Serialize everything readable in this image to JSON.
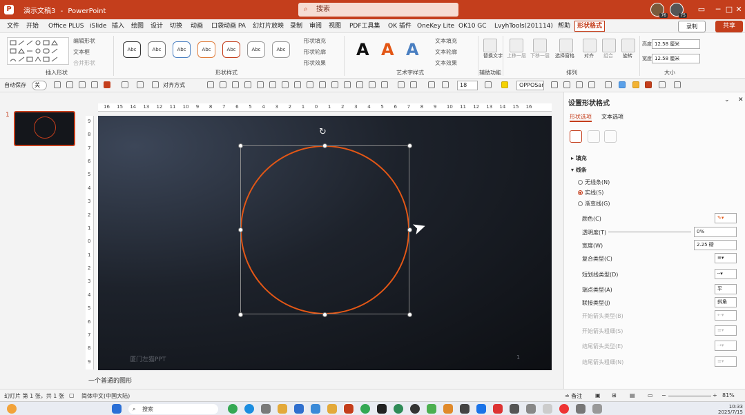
{
  "titlebar": {
    "app_name": "PowerPoint",
    "doc_title": "演示文稿3",
    "search_placeholder": "搜索",
    "avatar1_badge": "76",
    "avatar2_badge": "75",
    "minimize": "─",
    "restore": "□",
    "close": "✕"
  },
  "menubar": {
    "items": [
      "文件",
      "开始",
      "Office PLUS",
      "iSlide",
      "插入",
      "绘图",
      "设计",
      "切换",
      "动画",
      "口袋动画 PA",
      "幻灯片放映",
      "录制",
      "审阅",
      "视图",
      "PDF工具集",
      "OK 插件",
      "OneKey Lite",
      "OK10 GC",
      "LvyhTools(201114)",
      "帮助",
      "形状格式"
    ],
    "record_label": "录制",
    "share_label": "共享"
  },
  "ribbon": {
    "groups": [
      "插入形状",
      "形状样式",
      "艺术字样式",
      "辅助功能",
      "排列",
      "大小"
    ],
    "shape_edit": "编辑形状",
    "text_box": "文本框",
    "merge_shapes": "合并形状",
    "style_sample": "Abc",
    "fill": "形状填充",
    "outline": "形状轮廓",
    "effects": "形状效果",
    "text_fill": "文本填充",
    "text_outline": "文本轮廓",
    "text_effects": "文本效果",
    "alt_text": "替换文字",
    "bring_forward": "上移一层",
    "send_backward": "下移一层",
    "selection_pane": "选择窗格",
    "align": "对齐",
    "group": "组合",
    "rotate": "旋转",
    "height_label": "高度",
    "height_value": "12.58 厘米",
    "width_label": "宽度",
    "width_value": "12.58 厘米",
    "wordart": [
      "A",
      "A",
      "A"
    ]
  },
  "qat": {
    "autosave": "自动保存",
    "autosave_state": "关",
    "font_name": "OPPOSans",
    "font_size": "18",
    "align_label": "对齐方式"
  },
  "thumbnails": {
    "slide_number": "1"
  },
  "ruler_h_ticks": [
    "16",
    "15",
    "14",
    "13",
    "12",
    "11",
    "10",
    "9",
    "8",
    "7",
    "6",
    "5",
    "4",
    "3",
    "2",
    "1",
    "0",
    "1",
    "2",
    "3",
    "4",
    "5",
    "6",
    "7",
    "8",
    "9",
    "10",
    "11",
    "12",
    "13",
    "14",
    "15",
    "16"
  ],
  "ruler_v_ticks": [
    "9",
    "8",
    "7",
    "6",
    "5",
    "4",
    "3",
    "2",
    "1",
    "0",
    "1",
    "2",
    "3",
    "4",
    "5",
    "6",
    "7",
    "8",
    "9"
  ],
  "slide": {
    "footer": "厦门左猫PPT",
    "page_number": "1",
    "colors": {
      "circle": "#e35716",
      "bg_dark": "#0d0f13",
      "bg_light": "#3c4658"
    }
  },
  "notes": {
    "text": "一个普通的图形"
  },
  "statusbar": {
    "slide_info": "幻灯片 第 1 张，共 1 张",
    "language": "简体中文(中国大陆)",
    "notes": "备注",
    "zoom": "81%"
  },
  "panel": {
    "title": "设置形状格式",
    "tab_shape": "形状选项",
    "tab_text": "文本选项",
    "fill_section": "填充",
    "line_section": "线条",
    "radios": [
      "无线条(N)",
      "实线(S)",
      "渐变线(G)"
    ],
    "selected_radio_index": 1,
    "rows": [
      "颜色(C)",
      "透明度(T)",
      "宽度(W)",
      "复合类型(C)",
      "短划线类型(D)",
      "端点类型(A)",
      "联接类型(J)",
      "开始箭头类型(B)",
      "开始箭头粗细(S)",
      "结尾箭头类型(E)",
      "结尾箭头粗细(N)"
    ],
    "transparency_value": "0%",
    "width_value": "2.25 磅",
    "cap_value": "平",
    "join_value": "斜角"
  },
  "taskbar": {
    "search_placeholder": "搜索",
    "time": "10:33",
    "date": "2025/7/15"
  }
}
